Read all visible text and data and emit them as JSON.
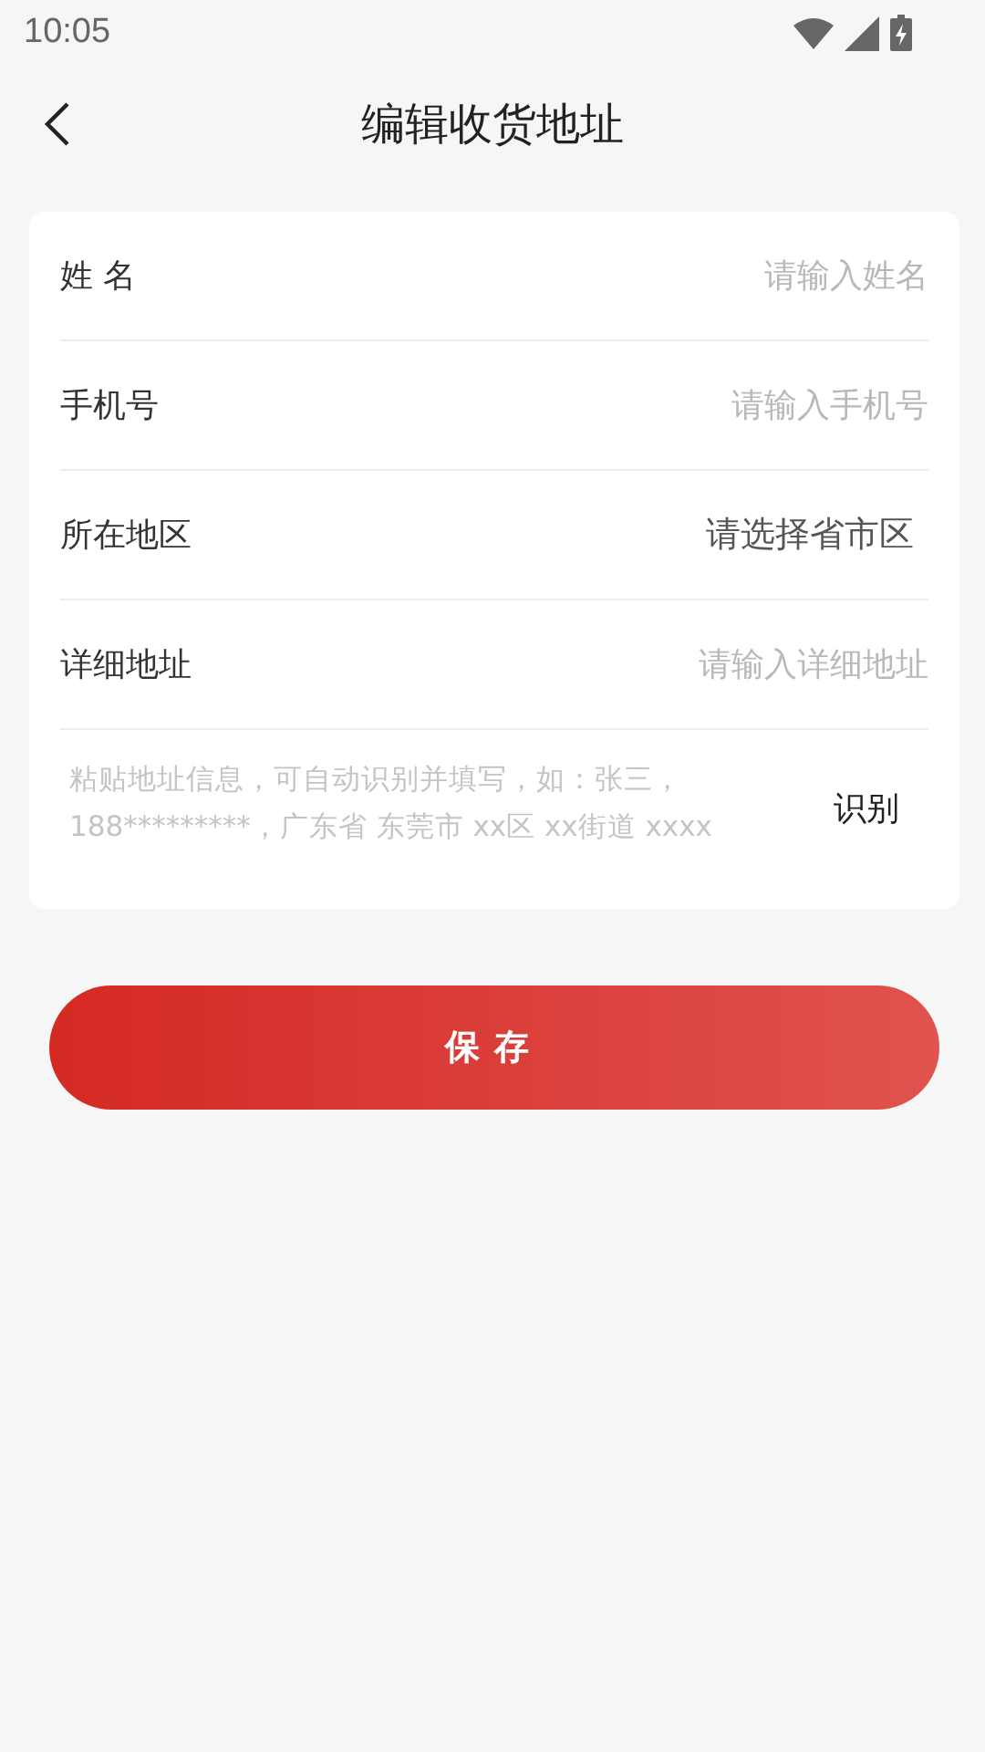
{
  "status_bar": {
    "time": "10:05"
  },
  "header": {
    "title": "编辑收货地址"
  },
  "form": {
    "fields": [
      {
        "kind": "input",
        "label": "姓 名",
        "placeholder": "请输入姓名"
      },
      {
        "kind": "input",
        "label": "手机号",
        "placeholder": "请输入手机号"
      },
      {
        "kind": "picker",
        "label": "所在地区",
        "placeholder": "请选择省市区"
      },
      {
        "kind": "input",
        "label": "详细地址",
        "placeholder": "请输入详细地址"
      }
    ],
    "paste": {
      "placeholder": "粘贴地址信息，可自动识别并填写，如：张三，188*********，广东省 东莞市 xx区 xx街道 xxxx",
      "button": "识别"
    }
  },
  "save_button": "保存"
}
